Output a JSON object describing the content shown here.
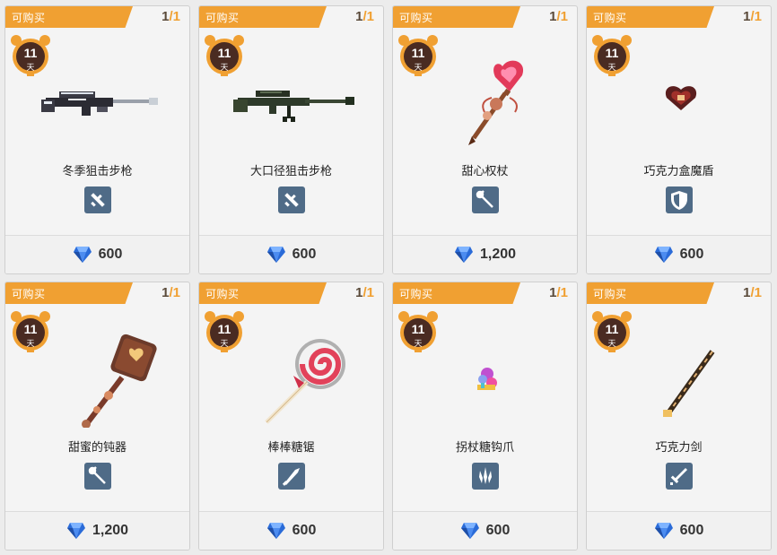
{
  "shop": {
    "items": [
      {
        "status": "可购买",
        "count": "1",
        "max": "1",
        "days": "11",
        "days_unit": "天",
        "name": "冬季狙击步枪",
        "type_icon": "gun-icon",
        "art": "winter-sniper-rifle-icon",
        "price": "600"
      },
      {
        "status": "可购买",
        "count": "1",
        "max": "1",
        "days": "11",
        "days_unit": "天",
        "name": "大口径狙击步枪",
        "type_icon": "gun-icon",
        "art": "heavy-sniper-rifle-icon",
        "price": "600"
      },
      {
        "status": "可购买",
        "count": "1",
        "max": "1",
        "days": "11",
        "days_unit": "天",
        "name": "甜心权杖",
        "type_icon": "staff-icon",
        "art": "heart-scepter-icon",
        "price": "1,200"
      },
      {
        "status": "可购买",
        "count": "1",
        "max": "1",
        "days": "11",
        "days_unit": "天",
        "name": "巧克力盒魔盾",
        "type_icon": "shield-icon",
        "art": "chocolate-box-shield-icon",
        "price": "600"
      },
      {
        "status": "可购买",
        "count": "1",
        "max": "1",
        "days": "11",
        "days_unit": "天",
        "name": "甜蜜的钝器",
        "type_icon": "staff-icon",
        "art": "sweet-mace-icon",
        "price": "1,200"
      },
      {
        "status": "可购买",
        "count": "1",
        "max": "1",
        "days": "11",
        "days_unit": "天",
        "name": "棒棒糖锯",
        "type_icon": "blade-icon",
        "art": "lollipop-saw-icon",
        "price": "600"
      },
      {
        "status": "可购买",
        "count": "1",
        "max": "1",
        "days": "11",
        "days_unit": "天",
        "name": "拐杖糖钩爪",
        "type_icon": "claw-icon",
        "art": "candy-cane-claw-icon",
        "price": "600"
      },
      {
        "status": "可购买",
        "count": "1",
        "max": "1",
        "days": "11",
        "days_unit": "天",
        "name": "巧克力剑",
        "type_icon": "sword-icon",
        "art": "chocolate-sword-icon",
        "price": "600"
      }
    ]
  },
  "colors": {
    "tag": "#f0a032",
    "type_icon_bg": "#4f6b87",
    "gem": "#2a6bd8"
  }
}
